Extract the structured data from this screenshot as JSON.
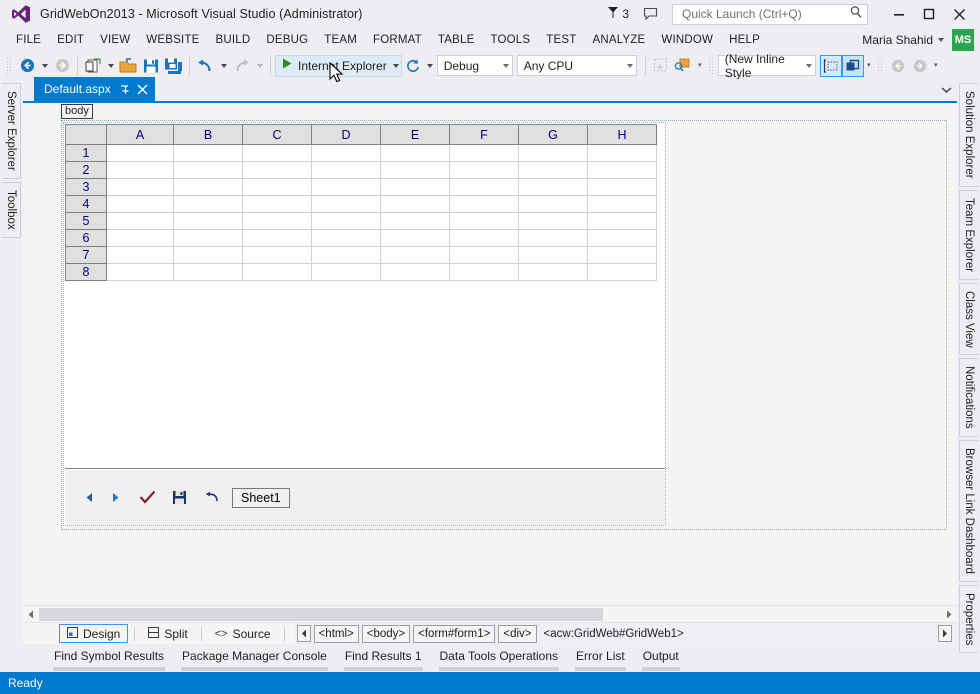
{
  "titlebar": {
    "app_title": "GridWebOn2013 - Microsoft Visual Studio (Administrator)",
    "logo_icon": "visual-studio-logo",
    "feedback_count": "3",
    "feedback_icon": "flag-icon",
    "speech_icon": "speech-bubble-icon",
    "quick_launch_placeholder": "Quick Launch (Ctrl+Q)",
    "quick_launch_value": "",
    "search_icon": "magnifier-icon",
    "minimize_icon": "minimize-icon",
    "maximize_icon": "maximize-icon",
    "close_icon": "close-icon"
  },
  "menubar": {
    "items": [
      "FILE",
      "EDIT",
      "VIEW",
      "WEBSITE",
      "BUILD",
      "DEBUG",
      "TEAM",
      "FORMAT",
      "TABLE",
      "TOOLS",
      "TEST",
      "ANALYZE",
      "WINDOW",
      "HELP"
    ],
    "user_name": "Maria Shahid",
    "user_initials": "MS",
    "user_caret_icon": "chevron-down-icon"
  },
  "toolbar": {
    "navigate_back_icon": "navigate-back-icon",
    "navigate_forward_icon": "navigate-forward-icon",
    "new_item_icon": "new-item-icon",
    "open_file_icon": "open-file-icon",
    "save_icon": "save-icon",
    "save_all_icon": "save-all-icon",
    "undo_icon": "undo-icon",
    "redo_icon": "redo-icon",
    "run_play_icon": "play-triangle-icon",
    "run_label": "Internet Explorer",
    "run_dropdown_icon": "chevron-down-icon",
    "refresh_icon": "refresh-icon",
    "config_value": "Debug",
    "platform_value": "Any CPU",
    "style_target_icon": "style-target-icon",
    "style_app_icon": "style-application-icon",
    "inline_style_value": "(New Inline Style",
    "select_tag_icon": "select-tag-icon",
    "expand_icon": "expand-recompose-icon",
    "prev_style_icon": "previous-style-icon",
    "next_style_icon": "next-style-icon",
    "overflow_icon": "toolbar-overflow-icon"
  },
  "left_dock": {
    "items": [
      "Server Explorer",
      "Toolbox"
    ]
  },
  "right_dock": {
    "items": [
      "Solution Explorer",
      "Team Explorer",
      "Class View",
      "Notifications",
      "Browser Link Dashboard",
      "Properties"
    ]
  },
  "document_tab": {
    "label": "Default.aspx",
    "pin_icon": "pin-icon",
    "close_icon": "close-icon",
    "overflow_icon": "tab-overflow-chevron-icon"
  },
  "designer": {
    "tag_selector": "body",
    "grid": {
      "corner_label": "",
      "columns": [
        "A",
        "B",
        "C",
        "D",
        "E",
        "F",
        "G",
        "H"
      ],
      "rows": [
        "1",
        "2",
        "3",
        "4",
        "5",
        "6",
        "7",
        "8"
      ]
    },
    "sheet_toolbar": {
      "prev_icon": "previous-sheet-icon",
      "next_icon": "next-sheet-icon",
      "submit_icon": "check-submit-icon",
      "save_icon": "floppy-save-icon",
      "undo_icon": "undo-arrow-icon",
      "sheet_name": "Sheet1"
    },
    "hscroll": {
      "left_icon": "scroll-left-icon",
      "right_icon": "scroll-right-icon"
    }
  },
  "viewbar": {
    "design_label": "Design",
    "design_icon": "design-view-icon",
    "split_label": "Split",
    "split_icon": "split-view-icon",
    "source_label": "Source",
    "source_icon": "source-view-icon",
    "breadcrumb_left_icon": "breadcrumb-scroll-left-icon",
    "breadcrumb_right_icon": "breadcrumb-scroll-right-icon",
    "breadcrumbs": [
      "<html>",
      "<body>",
      "<form#form1>",
      "<div>"
    ],
    "breadcrumb_current": "<acw:GridWeb#GridWeb1>"
  },
  "panel_tabs": {
    "items": [
      "Find Symbol Results",
      "Package Manager Console",
      "Find Results 1",
      "Data Tools Operations",
      "Error List",
      "Output"
    ]
  },
  "statusbar": {
    "text": "Ready"
  },
  "colors": {
    "accent": "#007ACC",
    "titlebar_bg": "#EEEEF2",
    "statusbar_bg": "#007ACC",
    "avatar_green": "#2DA44E",
    "grid_header_bg": "#E0E0E0",
    "grid_text": "#00007F"
  }
}
